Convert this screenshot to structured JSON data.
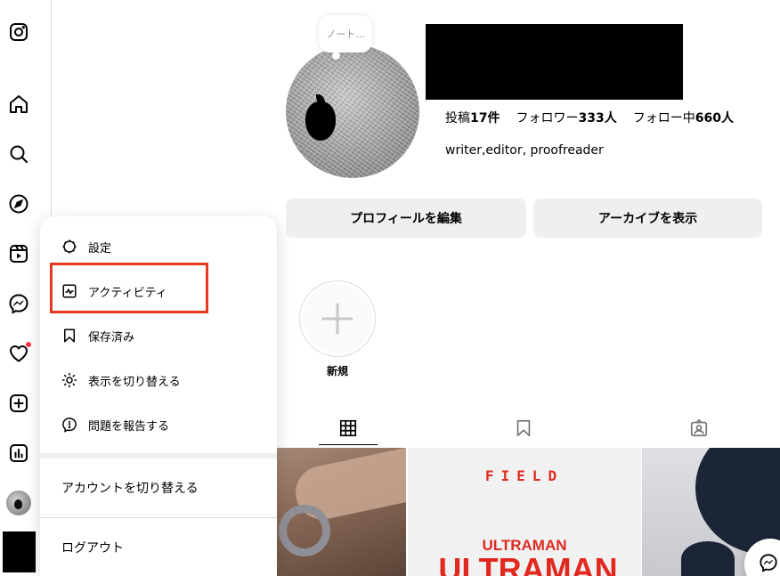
{
  "profile": {
    "note_placeholder": "ノート...",
    "stats": [
      {
        "label": "投稿",
        "value": "17件"
      },
      {
        "label": "フォロワー",
        "value": "333人"
      },
      {
        "label": "フォロー中",
        "value": "660人"
      }
    ],
    "bio": "writer,editor, proofreader",
    "edit_profile_label": "プロフィールを編集",
    "view_archive_label": "アーカイブを表示",
    "new_highlight_label": "新規"
  },
  "posts": {
    "post2_line1": "FIELD",
    "post2_line2": "ULTRAMAN",
    "post2_line3": "ULTRAMAN"
  },
  "menu": {
    "settings": "設定",
    "activity": "アクティビティ",
    "saved": "保存済み",
    "switch_appearance": "表示を切り替える",
    "report_problem": "問題を報告する",
    "switch_accounts": "アカウントを切り替える",
    "logout": "ログアウト"
  },
  "sidebar": {
    "icons": [
      "instagram-icon",
      "home-icon",
      "search-icon",
      "explore-icon",
      "reels-icon",
      "messenger-icon",
      "heart-icon",
      "create-icon",
      "insights-icon"
    ]
  },
  "colors": {
    "highlight_box": "#e8391e",
    "notification_dot": "#ff3040",
    "button_bg": "#efefef"
  }
}
